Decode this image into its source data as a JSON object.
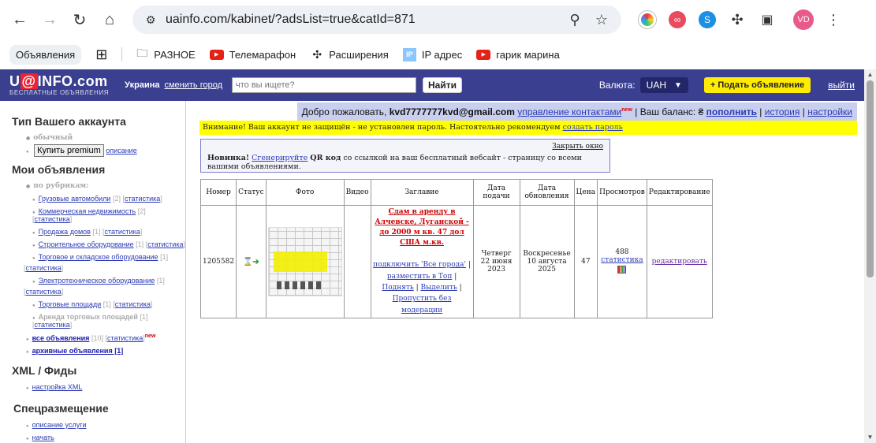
{
  "browser": {
    "url": "uainfo.com/kabinet/?adsList=true&catId=871",
    "profile_initials": "VD",
    "bookmarks": [
      {
        "label": "Объявления"
      },
      {
        "label": "РАЗНОЕ"
      },
      {
        "label": "Телемарафон"
      },
      {
        "label": "Расширения"
      },
      {
        "label": "IP адрес"
      },
      {
        "label": "гарик марина"
      }
    ]
  },
  "header": {
    "logo_main_pre": "U",
    "logo_main_at": "@",
    "logo_main_post": "INFO.com",
    "logo_sub": "БЕСПЛАТНЫЕ ОБЪЯВЛЕНИЯ",
    "region": "Украина",
    "change_region": "сменить город",
    "search_placeholder": "что вы ищете?",
    "search_button": "Найти",
    "currency_label": "Валюта:",
    "currency_value": "UAH",
    "add_ad": "+ Подать объявление",
    "logout": "выйти"
  },
  "sidebar": {
    "account_type_title": "Тип Вашего аккаунта",
    "account_type_value": "обычный",
    "premium_button": "Купить premium",
    "premium_desc": "описание",
    "my_ads_title": "Мои объявления",
    "by_category": "по рубрикам:",
    "categories": [
      {
        "name": "Грузовые автомобили",
        "count": "[2]",
        "stats": "статистика"
      },
      {
        "name": "Коммерческая недвижимость",
        "count": "[2]",
        "stats": "статистика"
      },
      {
        "name": "Продажа домов",
        "count": "[1]",
        "stats": "статистика"
      },
      {
        "name": "Строительное оборудование",
        "count": "[1]",
        "stats": "статистика"
      },
      {
        "name": "Торговое и складское оборудование",
        "count": "[1]",
        "stats": "статистика"
      },
      {
        "name": "Электротехническое оборудование",
        "count": "[1]",
        "stats": "статистика"
      },
      {
        "name": "Торговые площади",
        "count": "[1]",
        "stats": "статистика"
      },
      {
        "name": "Аренда торговых площадей",
        "count": "[1]",
        "stats": "статистика"
      }
    ],
    "all_ads": "все объявления",
    "all_ads_count": "[10]",
    "all_ads_stats": "статистика",
    "new_badge": "new",
    "archived": "архивные объявления [1]",
    "xml_title": "XML / Фиды",
    "xml_setup": "настройка XML",
    "special_title": "Спецразмещение",
    "special_desc": "описание услуги",
    "special_start": "начать"
  },
  "welcome": {
    "greeting": "Добро пожаловать,",
    "email": "kvd7777777kvd@gmail.com",
    "manage_contacts": "управление контактами",
    "new_badge": "new",
    "balance_label": "| Ваш баланс: ₴",
    "top_up": "пополнить",
    "history": "история",
    "settings": "настройки"
  },
  "warning": {
    "text": "Внимание! Ваш аккаунт не защищён - не установлен пароль. Настоятельно рекомендуем",
    "link": "создать пароль"
  },
  "qr": {
    "close": "Закрыть окно",
    "new_label": "Новинка!",
    "generate": "Сгенерируйте",
    "qr_label": "QR код",
    "rest": "со ссылкой на ваш бесплатный вебсайт - страницу со всеми вашими объявлениями."
  },
  "table": {
    "headers": [
      "Номер",
      "Статус",
      "Фото",
      "Видео",
      "Заглавие",
      "Дата подачи",
      "Дата обновления",
      "Цена",
      "Просмотров",
      "Редактирование"
    ],
    "row": {
      "number": "1205582",
      "title": "Сдам в аренду в Алчевске, Луганской - до 2000 м кв. 47 дол США м.кв.",
      "action_connect": "подключить 'Все города'",
      "action_top": "разместить в Топ",
      "action_raise": "Поднять",
      "action_highlight": "Выделить",
      "action_skip": "Пропустить без модерации",
      "date_submitted_day": "Четверг",
      "date_submitted": "22 июня 2023",
      "date_updated_day": "Воскресенье",
      "date_updated": "10 августа 2025",
      "price": "47",
      "views": "488",
      "views_stats": "статистика",
      "edit": "редактировать"
    }
  }
}
